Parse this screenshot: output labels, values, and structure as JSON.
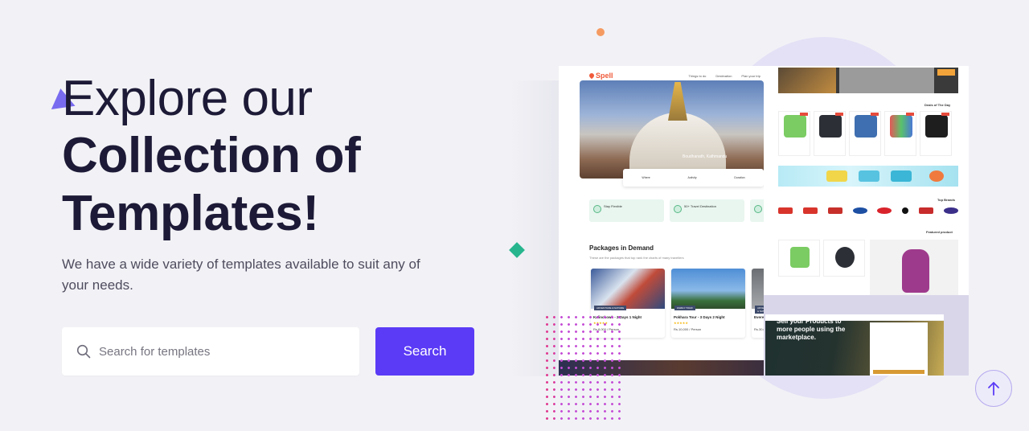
{
  "hero": {
    "title_line1": "Explore our",
    "title_line2": "Collection of",
    "title_line3": "Templates!",
    "description": "We have a wide variety of templates available to suit any of your needs."
  },
  "search": {
    "placeholder": "Search for templates",
    "button_label": "Search"
  },
  "icons": {
    "search": "search-icon",
    "scroll_top": "arrow-up-icon"
  },
  "colors": {
    "accent": "#5b3bf6",
    "heading": "#1c1a36",
    "background": "#f2f2f6"
  },
  "preview": {
    "travel": {
      "logo": "Spell",
      "nav": [
        "Things to do",
        "Destination",
        "Plan your trip"
      ],
      "hero_caption": "Boudhanath, Kathmandu",
      "info_fields": [
        "Where",
        "Activity",
        "Duration"
      ],
      "features": [
        "Stay Flexible",
        "50+ Travel Destination"
      ],
      "packages_title": "Packages in Demand",
      "packages_subtitle": "These are the packages that top rank the charts of many travellers",
      "cards": [
        {
          "tag": "ADVENTURE & NATURE",
          "name": "Kalinchowk - 2 Days 1 Night",
          "price": "Rs.8,000 / Person"
        },
        {
          "tag": "FAMILY TOUR",
          "name": "Pokhara Tour - 3 Days 2 Night",
          "price": "Rs.10,000 / Person"
        },
        {
          "tag": "ADVENTURE & NATURE",
          "name": "Everest",
          "price": "Rs.30,0"
        }
      ]
    },
    "market": {
      "deals_title": "Deals of The Day",
      "brands_title": "Top Brands",
      "featured_title": "Featured product",
      "seller_title": "Sell your Products to more people using the marketplace."
    }
  }
}
